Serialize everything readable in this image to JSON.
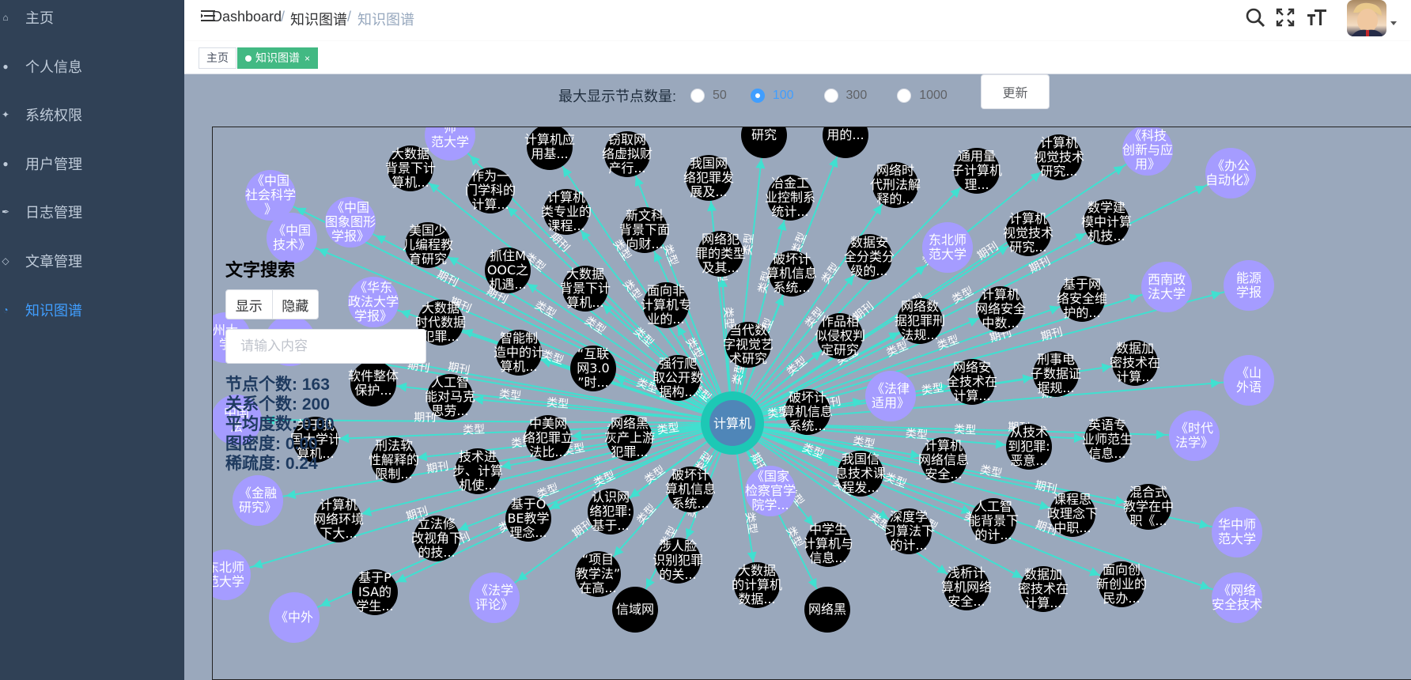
{
  "sidebar": {
    "items": [
      {
        "label": "主页",
        "icon": "home-icon"
      },
      {
        "label": "个人信息",
        "icon": "user-icon"
      },
      {
        "label": "系统权限",
        "icon": "permission-icon"
      },
      {
        "label": "用户管理",
        "icon": "users-icon"
      },
      {
        "label": "日志管理",
        "icon": "feather-icon"
      },
      {
        "label": "文章管理",
        "icon": "article-icon"
      },
      {
        "label": "知识图谱",
        "icon": "graph-icon",
        "active": true
      }
    ]
  },
  "header": {
    "breadcrumb": [
      "Dashboard",
      "知识图谱",
      "知识图谱"
    ],
    "separator": "/",
    "icons": [
      "search-icon",
      "fullscreen-icon",
      "font-size-icon",
      "avatar",
      "caret-down-icon"
    ]
  },
  "tags": [
    {
      "label": "主页",
      "active": false
    },
    {
      "label": "知识图谱",
      "active": true,
      "close": "×"
    }
  ],
  "controls": {
    "label": "最大显示节点数量:",
    "options": [
      "50",
      "100",
      "300",
      "1000"
    ],
    "selected": "100",
    "update_label": "更新"
  },
  "panel": {
    "title": "文字搜索",
    "show_label": "显示",
    "hide_label": "隐藏",
    "search_placeholder": "请输入内容",
    "stats": [
      {
        "label": "节点个数:",
        "value": "163"
      },
      {
        "label": "关系个数:",
        "value": "200"
      },
      {
        "label": "平均度数:",
        "value": "0.00"
      },
      {
        "label": "图密度:",
        "value": "0.00"
      },
      {
        "label": "稀疏度:",
        "value": "0.24"
      }
    ]
  },
  "colors": {
    "sidebar_bg": "#304156",
    "active_menu": "#409eff",
    "tag_active": "#42b983",
    "graph_bg": "#9aa8bc",
    "edge": "#40e0d0",
    "paper_node": "#000000",
    "journal_node": "#a59cff",
    "center_node": "#4f86b8",
    "center_ring": "#1dc8b5"
  },
  "graph": {
    "center": {
      "label": "计算机"
    },
    "nodes": [
      {
        "t": "p",
        "lines": [
          "大数据",
          "背景下计",
          "算机..."
        ]
      },
      {
        "t": "p",
        "lines": [
          "作为一",
          "门学科的",
          "计算..."
        ]
      },
      {
        "t": "p",
        "lines": [
          "计算机应",
          "用基..."
        ]
      },
      {
        "t": "p",
        "lines": [
          "窃取网",
          "络虚拟财",
          "产行..."
        ]
      },
      {
        "t": "p",
        "lines": [
          "我国网",
          "络犯罪发",
          "展及..."
        ]
      },
      {
        "t": "p",
        "lines": [
          "研究"
        ]
      },
      {
        "t": "p",
        "lines": [
          "用的..."
        ]
      },
      {
        "t": "p",
        "lines": [
          "冶金工",
          "业控制系",
          "统计..."
        ]
      },
      {
        "t": "p",
        "lines": [
          "网络时",
          "代刑法解",
          "释的..."
        ]
      },
      {
        "t": "p",
        "lines": [
          "通用量",
          "子计算机",
          "理..."
        ]
      },
      {
        "t": "p",
        "lines": [
          "计算机",
          "视觉技术",
          "研究..."
        ]
      },
      {
        "t": "j",
        "lines": [
          "《科技",
          "创新与应",
          "用》"
        ]
      },
      {
        "t": "j",
        "lines": [
          "《办公",
          "自动化》"
        ]
      },
      {
        "t": "j",
        "lines": [
          "《中国",
          "社会科学",
          "》"
        ]
      },
      {
        "t": "j",
        "lines": [
          "《中国",
          "图象图形",
          "学报》"
        ]
      },
      {
        "t": "p",
        "lines": [
          "美国少",
          "儿编程教",
          "育研究"
        ]
      },
      {
        "t": "p",
        "lines": [
          "计算机",
          "类专业的",
          "课程..."
        ]
      },
      {
        "t": "p",
        "lines": [
          "新文科",
          "背景下面",
          "向财..."
        ]
      },
      {
        "t": "p",
        "lines": [
          "网络犯",
          "罪的类型",
          "及其..."
        ]
      },
      {
        "t": "p",
        "lines": [
          "破坏计",
          "算机信息",
          "系统..."
        ]
      },
      {
        "t": "p",
        "lines": [
          "数据安",
          "全分类分",
          "级的..."
        ]
      },
      {
        "t": "j",
        "lines": [
          "东北师",
          "范大学"
        ]
      },
      {
        "t": "p",
        "lines": [
          "计算机",
          "视觉技术",
          "研究..."
        ]
      },
      {
        "t": "p",
        "lines": [
          "数学建",
          "模中计算",
          "机技..."
        ]
      },
      {
        "t": "j",
        "lines": [
          "《华东",
          "政法大学",
          "学报》"
        ]
      },
      {
        "t": "p",
        "lines": [
          "抓住M",
          "OOC之",
          "机遇..."
        ]
      },
      {
        "t": "p",
        "lines": [
          "大数据",
          "背景下计",
          "算机..."
        ]
      },
      {
        "t": "p",
        "lines": [
          "面向非",
          "计算机专",
          "业的..."
        ]
      },
      {
        "t": "p",
        "lines": [
          "当代数",
          "字视觉艺",
          "术研究"
        ]
      },
      {
        "t": "p",
        "lines": [
          "作品相",
          "似侵权判",
          "定研究"
        ]
      },
      {
        "t": "p",
        "lines": [
          "网络数",
          "据犯罪刑",
          "法规..."
        ]
      },
      {
        "t": "p",
        "lines": [
          "计算机",
          "网络安全",
          "中数..."
        ]
      },
      {
        "t": "p",
        "lines": [
          "基于网",
          "络安全维",
          "护的..."
        ]
      },
      {
        "t": "j",
        "lines": [
          "西南政",
          "法大学"
        ]
      },
      {
        "t": "p",
        "lines": [
          "大数据",
          "时代数据",
          "犯罪..."
        ]
      },
      {
        "t": "p",
        "lines": [
          "智能制",
          "造中的计",
          "算机..."
        ]
      },
      {
        "t": "p",
        "lines": [
          "“互联",
          "网3.0",
          "”时..."
        ]
      },
      {
        "t": "p",
        "lines": [
          "强行爬",
          "取公开数",
          "据构..."
        ]
      },
      {
        "t": "p",
        "lines": [
          "网络安",
          "全技术在",
          "计算..."
        ]
      },
      {
        "t": "p",
        "lines": [
          "刑事电",
          "子数据证",
          "据规..."
        ]
      },
      {
        "t": "p",
        "lines": [
          "数据加",
          "密技术在",
          "计算..."
        ]
      },
      {
        "t": "p",
        "lines": [
          "软件整体",
          "保护..."
        ]
      },
      {
        "t": "p",
        "lines": [
          "人工智",
          "能对马克",
          "思劳..."
        ]
      },
      {
        "t": "j",
        "lines": [
          "《法律",
          "适用》"
        ]
      },
      {
        "t": "p",
        "lines": [
          "破坏计",
          "算机信息",
          "系统..."
        ]
      },
      {
        "t": "p",
        "lines": [
          "关于我",
          "国大学计",
          "算机..."
        ]
      },
      {
        "t": "p",
        "lines": [
          "刑法软",
          "性解释的",
          "限制..."
        ]
      },
      {
        "t": "p",
        "lines": [
          "中美网",
          "络犯罪立",
          "法比..."
        ]
      },
      {
        "t": "p",
        "lines": [
          "网络黑",
          "灰产上游",
          "犯罪..."
        ]
      },
      {
        "t": "p",
        "lines": [
          "技术进",
          "步、计算",
          "机使..."
        ]
      },
      {
        "t": "p",
        "lines": [
          "计算机",
          "网络信息",
          "安全..."
        ]
      },
      {
        "t": "p",
        "lines": [
          "从技术",
          "到犯罪:",
          "恶意..."
        ]
      },
      {
        "t": "p",
        "lines": [
          "英语专",
          "业师范生",
          "信息..."
        ]
      },
      {
        "t": "j",
        "lines": [
          "《时代",
          "法学》"
        ]
      },
      {
        "t": "j",
        "lines": [
          "《金融",
          "研究》"
        ]
      },
      {
        "t": "p",
        "lines": [
          "计算机",
          "网络环境",
          "下大..."
        ]
      },
      {
        "t": "p",
        "lines": [
          "基于O",
          "BE教学",
          "理念..."
        ]
      },
      {
        "t": "p",
        "lines": [
          "认识网",
          "络犯罪:",
          "基于..."
        ]
      },
      {
        "t": "p",
        "lines": [
          "破坏计",
          "算机信息",
          "系统..."
        ]
      },
      {
        "t": "j",
        "lines": [
          "《国家",
          "检察官学",
          "院学..."
        ]
      },
      {
        "t": "p",
        "lines": [
          "我国信",
          "息技术课",
          "程发..."
        ]
      },
      {
        "t": "p",
        "lines": [
          "人工智",
          "能背景下",
          "的计..."
        ]
      },
      {
        "t": "p",
        "lines": [
          "课程思",
          "政理念下",
          "中职..."
        ]
      },
      {
        "t": "p",
        "lines": [
          "混合式",
          "教学在中",
          "职《..."
        ]
      },
      {
        "t": "j",
        "lines": [
          "华中师",
          "范大学"
        ]
      },
      {
        "t": "p",
        "lines": [
          "立法修",
          "改视角下",
          "的技..."
        ]
      },
      {
        "t": "p",
        "lines": [
          "深度学",
          "习算法下",
          "的计..."
        ]
      },
      {
        "t": "p",
        "lines": [
          "中学生",
          "计算机与",
          "信息..."
        ]
      },
      {
        "t": "p",
        "lines": [
          "涉人脸",
          "识别犯罪",
          "的关..."
        ]
      },
      {
        "t": "p",
        "lines": [
          "“项目",
          "教学法”",
          "在高..."
        ]
      },
      {
        "t": "p",
        "lines": [
          "大数据",
          "的计算机",
          "数据..."
        ]
      },
      {
        "t": "p",
        "lines": [
          "浅析计",
          "算机网络",
          "安全..."
        ]
      },
      {
        "t": "p",
        "lines": [
          "数据加",
          "密技术在",
          "计算..."
        ]
      },
      {
        "t": "p",
        "lines": [
          "面向创",
          "新创业的",
          "民办..."
        ]
      },
      {
        "t": "j",
        "lines": [
          "《网络",
          "安全技术"
        ]
      },
      {
        "t": "j",
        "lines": [
          "东北师",
          "范大学"
        ]
      },
      {
        "t": "p",
        "lines": [
          "基于P",
          "ISA的",
          "学生..."
        ]
      },
      {
        "t": "j",
        "lines": [
          "《法学",
          "评论》"
        ]
      },
      {
        "t": "j",
        "lines": [
          "《中外"
        ]
      },
      {
        "t": "p",
        "lines": [
          "网络黑"
        ]
      },
      {
        "t": "p",
        "lines": [
          "信域网"
        ]
      },
      {
        "t": "j",
        "lines": [
          "能源",
          "学报"
        ]
      },
      {
        "t": "j",
        "lines": [
          "《山",
          "外语"
        ]
      },
      {
        "t": "j",
        "lines": [
          "《社会"
        ]
      },
      {
        "t": "j",
        "lines": [
          "州大",
          "学"
        ]
      },
      {
        "t": "j",
        "lines": [
          "中国",
          "法"
        ]
      },
      {
        "t": "j",
        "lines": [
          "《中国",
          "技术》"
        ]
      },
      {
        "t": "j",
        "lines": [
          "师",
          "范大学"
        ]
      }
    ],
    "edge_labels": [
      "期刊",
      "类型"
    ]
  }
}
